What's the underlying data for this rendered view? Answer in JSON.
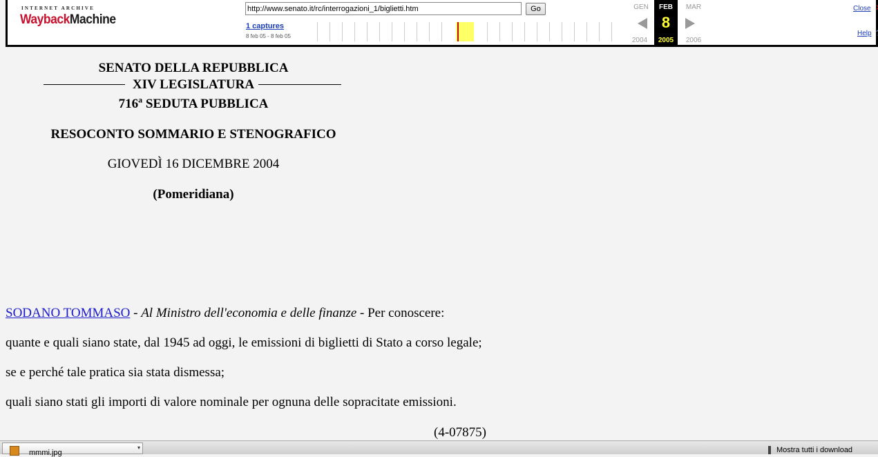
{
  "wayback": {
    "logo_top": "INTERNET ARCHIVE",
    "logo_main_1": "Wayback",
    "logo_main_2": "Machine",
    "url_value": "http://www.senato.it/rc/interrogazioni_1/biglietti.htm",
    "go_label": "Go",
    "captures_label": "1 captures",
    "captures_range": "8 feb 05 - 8 feb 05",
    "prev_month": "GEN",
    "cur_month": "FEB",
    "next_month": "MAR",
    "cur_day": "8",
    "prev_year": "2004",
    "cur_year": "2005",
    "next_year": "2006",
    "close_label": "Close",
    "help_label": "Help",
    "colors": {
      "highlight": "#ffff66",
      "marker": "#cc0000",
      "link": "#1a3db8"
    }
  },
  "doc": {
    "header_1": "SENATO DELLA REPUBBLICA",
    "header_2": "XIV LEGISLATURA",
    "seduta_num": "716",
    "seduta_sup": "a",
    "seduta_text": " SEDUTA PUBBLICA",
    "resoconto": "RESOCONTO SOMMARIO E STENOGRAFICO",
    "date": "GIOVEDÌ 16 DICEMBRE 2004",
    "session": "(Pomeridiana)",
    "author": "SODANO TOMMASO",
    "sep1": " - ",
    "recipient": "Al Ministro dell'economia e delle finanze",
    "intro": " - Per conoscere:",
    "q1": "quante e quali siano state, dal 1945 ad oggi, le emissioni di biglietti di Stato a corso legale;",
    "q2": "se e perché tale pratica sia stata dismessa;",
    "q3": "quali siano stati gli importi di valore nominale per ognuna delle sopracitate emissioni.",
    "ref": "(4-07875)"
  },
  "taskbar": {
    "item_label": "mmmi.jpg",
    "show_all": "Mostra tutti i download"
  }
}
